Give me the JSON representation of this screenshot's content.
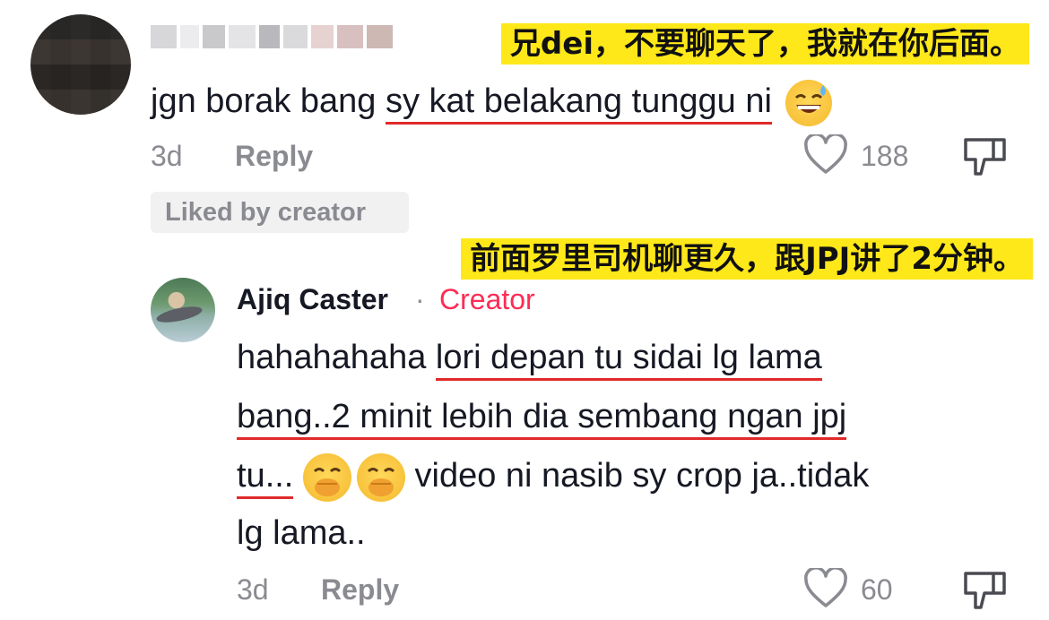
{
  "captions": {
    "first": "兄dei，不要聊天了，我就在你后面。",
    "second": "前面罗里司机聊更久，跟JPJ讲了2分钟。"
  },
  "comment1": {
    "text_plain": "jgn borak bang ",
    "text_underlined": "sy kat belakang tunggu ni",
    "emoji": "sweat-smile-emoji",
    "time": "3d",
    "reply_label": "Reply",
    "likes": "188",
    "badge": "Liked by creator"
  },
  "comment2": {
    "author": "Ajiq Caster",
    "separator": "·",
    "role": "Creator",
    "line1_plain": "hahahahaha ",
    "line1_underlined": "lori depan tu sidai lg lama",
    "line2_underlined": "bang..2 minit lebih dia sembang ngan jpj",
    "line3_underlined": "tu...",
    "line3_rest": " video ni nasib sy crop ja..tidak",
    "line4": "lg lama..",
    "emoji": "hand-over-mouth-emoji",
    "time": "3d",
    "reply_label": "Reply",
    "likes": "60"
  },
  "colors": {
    "accent_creator": "#fe2c55",
    "caption_bg": "#ffe81a",
    "underline": "#e02a2a",
    "meta_gray": "#8a8b91"
  }
}
